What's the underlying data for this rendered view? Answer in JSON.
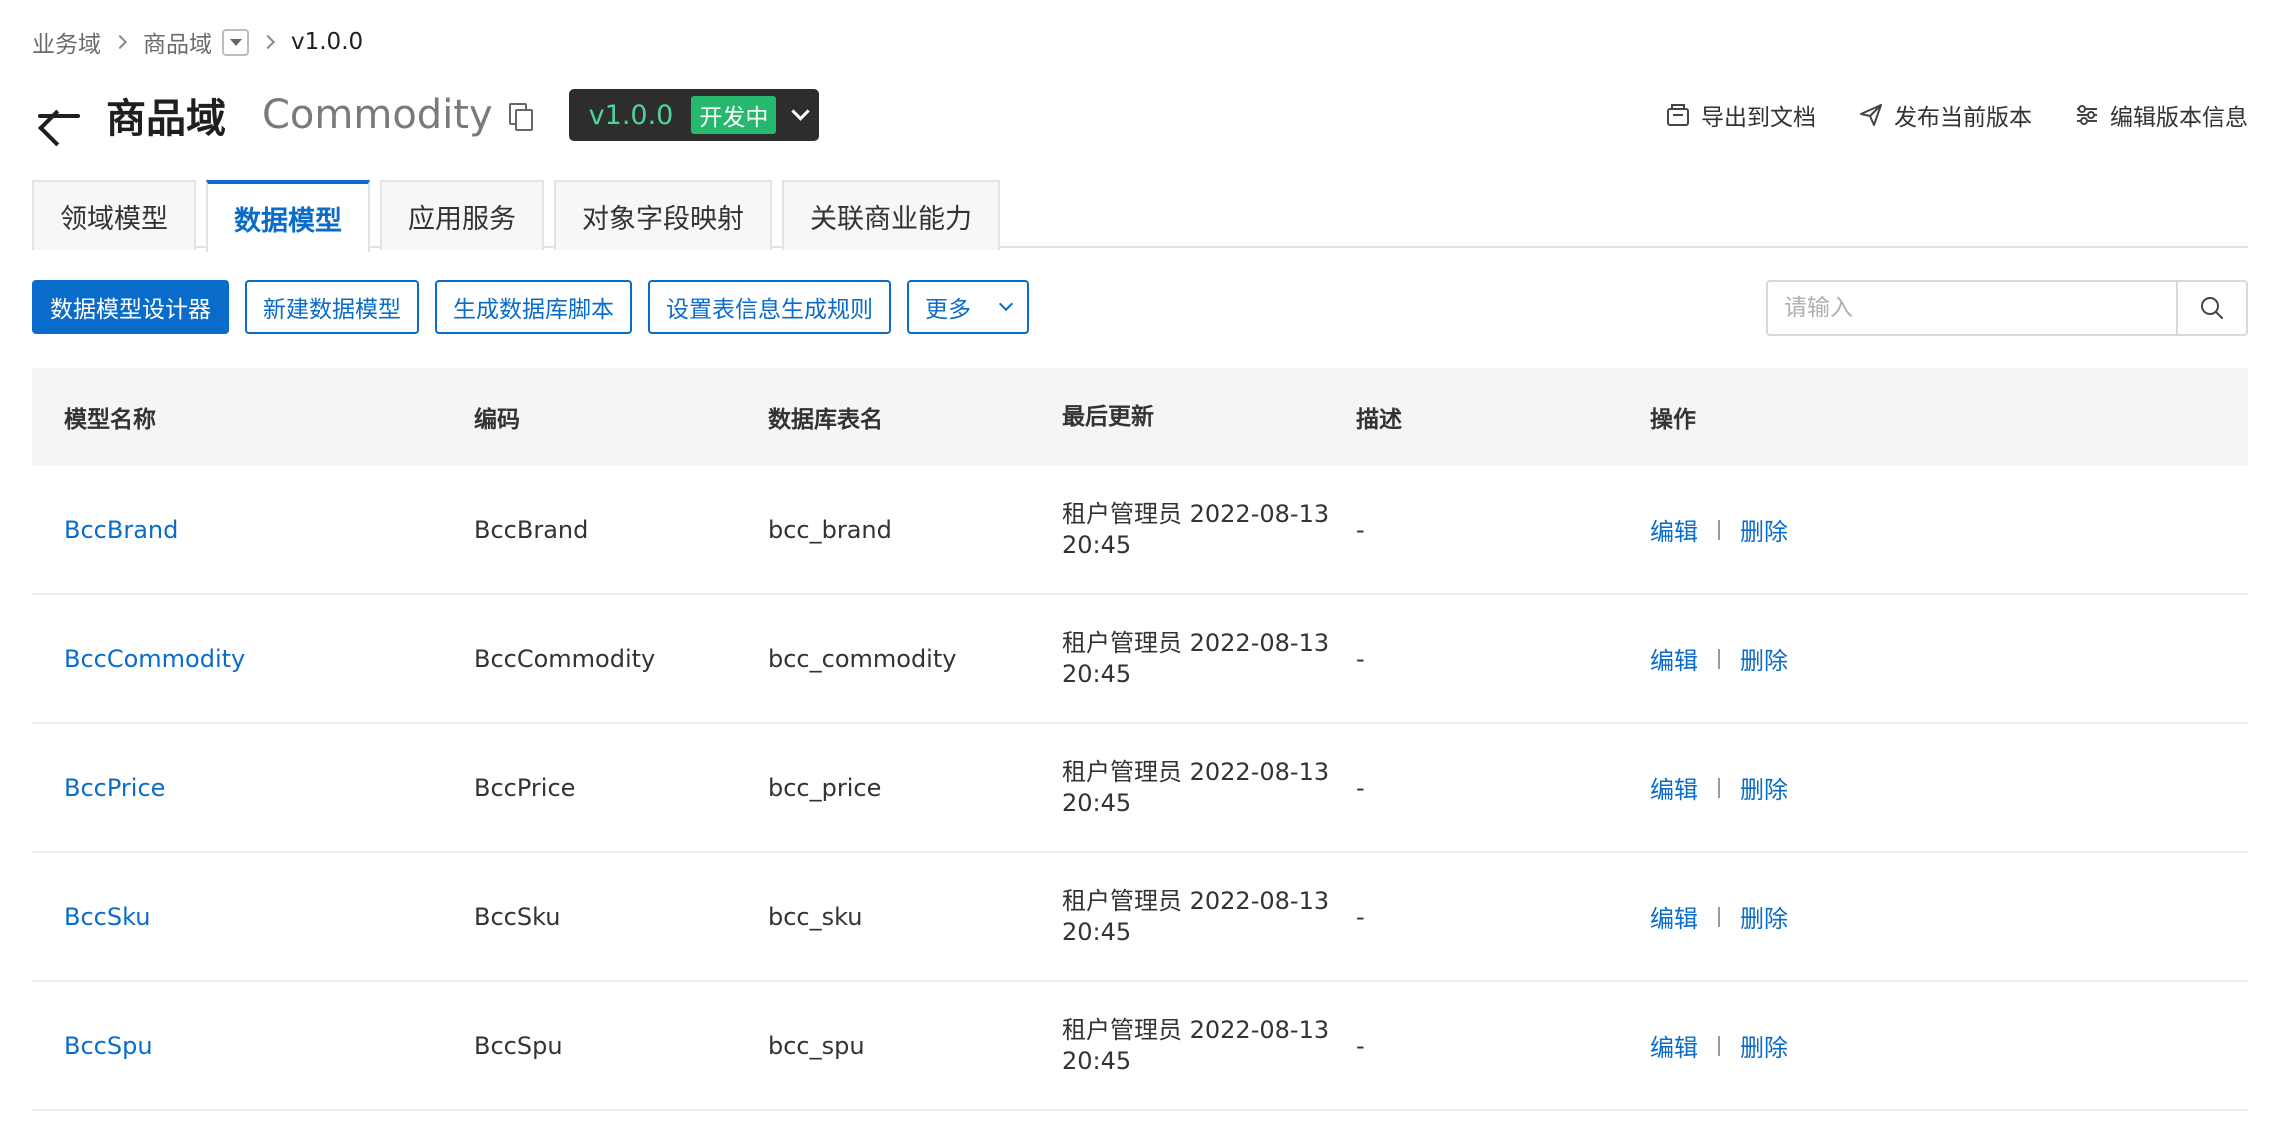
{
  "breadcrumb": {
    "items": [
      "业务域",
      "商品域"
    ],
    "current": "v1.0.0"
  },
  "header": {
    "title_cn": "商品域",
    "title_en": "Commodity",
    "version": "v1.0.0",
    "status": "开发中",
    "actions": {
      "export": "导出到文档",
      "publish": "发布当前版本",
      "edit_version": "编辑版本信息"
    }
  },
  "tabs": [
    {
      "label": "领域模型"
    },
    {
      "label": "数据模型"
    },
    {
      "label": "应用服务"
    },
    {
      "label": "对象字段映射"
    },
    {
      "label": "关联商业能力"
    }
  ],
  "active_tab": "数据模型",
  "toolbar": {
    "designer": "数据模型设计器",
    "new_model": "新建数据模型",
    "gen_script": "生成数据库脚本",
    "table_rule": "设置表信息生成规则",
    "more": "更多"
  },
  "search": {
    "placeholder": "请输入"
  },
  "table": {
    "columns": {
      "name": "模型名称",
      "code": "编码",
      "db_table": "数据库表名",
      "updated": "最后更新",
      "desc": "描述",
      "ops": "操作"
    },
    "rows": [
      {
        "name": "BccBrand",
        "code": "BccBrand",
        "db_table": "bcc_brand",
        "updated": "租户管理员 2022-08-13 20:45",
        "desc": "-",
        "edit": "编辑",
        "delete": "删除"
      },
      {
        "name": "BccCommodity",
        "code": "BccCommodity",
        "db_table": "bcc_commodity",
        "updated": "租户管理员 2022-08-13 20:45",
        "desc": "-",
        "edit": "编辑",
        "delete": "删除"
      },
      {
        "name": "BccPrice",
        "code": "BccPrice",
        "db_table": "bcc_price",
        "updated": "租户管理员 2022-08-13 20:45",
        "desc": "-",
        "edit": "编辑",
        "delete": "删除"
      },
      {
        "name": "BccSku",
        "code": "BccSku",
        "db_table": "bcc_sku",
        "updated": "租户管理员 2022-08-13 20:45",
        "desc": "-",
        "edit": "编辑",
        "delete": "删除"
      },
      {
        "name": "BccSpu",
        "code": "BccSpu",
        "db_table": "bcc_spu",
        "updated": "租户管理员 2022-08-13 20:45",
        "desc": "-",
        "edit": "编辑",
        "delete": "删除"
      }
    ]
  },
  "colors": {
    "primary": "#0a6cca",
    "version_bg": "#2d2d2d",
    "version_text": "#4ed39a",
    "status_bg": "#27b870"
  }
}
